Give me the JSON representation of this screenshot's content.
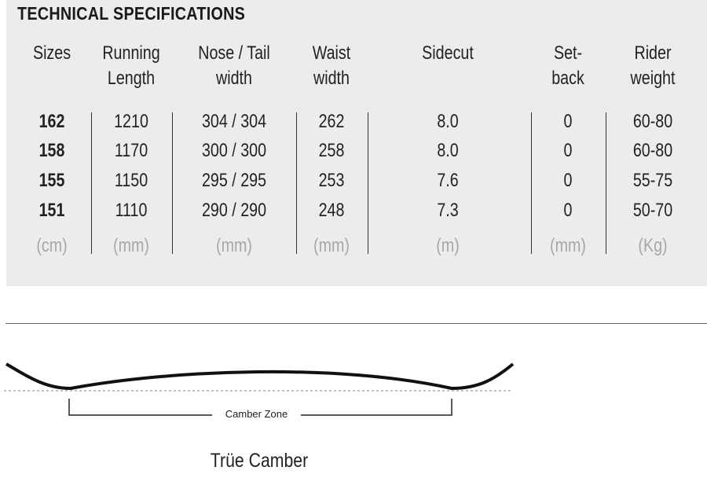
{
  "spec": {
    "title": "TECHNICAL SPECIFICATIONS",
    "headers": [
      [
        "Sizes"
      ],
      [
        "Running",
        "Length"
      ],
      [
        "Nose / Tail",
        "width"
      ],
      [
        "Waist",
        "width"
      ],
      [
        "Sidecut"
      ],
      [
        "Set-",
        "back"
      ],
      [
        "Rider",
        "weight"
      ]
    ],
    "rows": [
      [
        "162",
        "1210",
        "304 / 304",
        "262",
        "8.0",
        "0",
        "60-80"
      ],
      [
        "158",
        "1170",
        "300 / 300",
        "258",
        "8.0",
        "0",
        "60-80"
      ],
      [
        "155",
        "1150",
        "295 / 295",
        "253",
        "7.6",
        "0",
        "55-75"
      ],
      [
        "151",
        "1110",
        "290 / 290",
        "248",
        "7.3",
        "0",
        "50-70"
      ]
    ],
    "units": [
      "(cm)",
      "(mm)",
      "(mm)",
      "(mm)",
      "(m)",
      "(mm)",
      "(Kg)"
    ]
  },
  "profile": {
    "zone_label": "Camber Zone",
    "name": "Trüe Camber"
  },
  "colors": {
    "panel_bg": "#ececec",
    "text": "#1a1a1a",
    "unit_text": "#a7a7a7"
  }
}
